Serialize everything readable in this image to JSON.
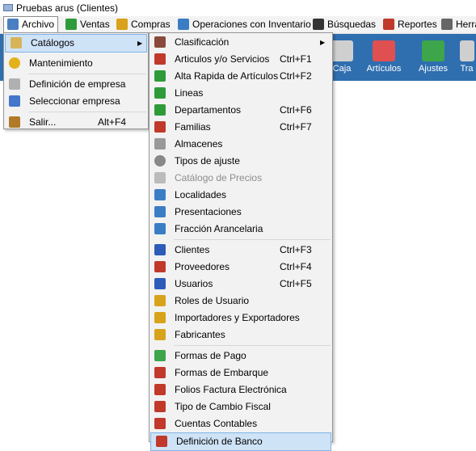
{
  "window": {
    "title": "Pruebas arus (Clientes)"
  },
  "menubar": {
    "items": [
      {
        "label": "Archivo",
        "icon": "folder-icon",
        "color": "#4a7fc1"
      },
      {
        "label": "Ventas",
        "icon": "dollar-icon",
        "color": "#2e9b3a"
      },
      {
        "label": "Compras",
        "icon": "coins-icon",
        "color": "#d9a21b"
      },
      {
        "label": "Operaciones con Inventario",
        "icon": "inventory-icon",
        "color": "#3b7dc4"
      },
      {
        "label": "Búsquedas",
        "icon": "binoculars-icon",
        "color": "#333333"
      },
      {
        "label": "Reportes",
        "icon": "report-icon",
        "color": "#c0392b"
      },
      {
        "label": "Herra",
        "icon": "wrench-icon",
        "color": "#666666"
      }
    ]
  },
  "toolbar": {
    "buttons": [
      {
        "label": "Caja",
        "icon": "cash-register-icon",
        "color": "#cfcfcf"
      },
      {
        "label": "Artículos",
        "icon": "abc-check-icon",
        "color": "#e05050"
      },
      {
        "label": "Ajustes",
        "icon": "adjust-icon",
        "color": "#3da54a"
      },
      {
        "label": "Tra",
        "icon": "transfer-icon",
        "color": "#cfcfcf"
      }
    ]
  },
  "archivo_menu": {
    "items": [
      {
        "label": "Catálogos",
        "shortcut": "",
        "submenu": true,
        "highlighted": true,
        "icon": "catalog-icon",
        "color": "#d7b45a"
      },
      {
        "label": "Mantenimiento",
        "shortcut": "",
        "icon": "maintenance-icon",
        "color": "#e3b11a"
      },
      {
        "separator": true
      },
      {
        "label": "Definición de empresa",
        "shortcut": "",
        "icon": "company-icon",
        "color": "#b0b0b0"
      },
      {
        "label": "Seleccionar empresa",
        "shortcut": "",
        "icon": "select-company-icon",
        "color": "#4477cc"
      },
      {
        "separator": true
      },
      {
        "label": "Salir...",
        "shortcut": "Alt+F4",
        "icon": "exit-icon",
        "color": "#b07a2a"
      }
    ]
  },
  "catalogos_menu": {
    "items": [
      {
        "label": "Clasificación",
        "shortcut": "",
        "submenu": true,
        "icon": "classification-icon",
        "color": "#8a4a3a"
      },
      {
        "label": "Articulos y/o Servicios",
        "shortcut": "Ctrl+F1",
        "icon": "articles-icon",
        "color": "#c0392b"
      },
      {
        "label": "Alta Rapida de Artículos",
        "shortcut": "Ctrl+F2",
        "icon": "quick-add-icon",
        "color": "#2e9b3a"
      },
      {
        "label": "Lineas",
        "shortcut": "",
        "icon": "lines-icon",
        "color": "#2e9b3a"
      },
      {
        "label": "Departamentos",
        "shortcut": "Ctrl+F6",
        "icon": "departments-icon",
        "color": "#2e9b3a"
      },
      {
        "label": "Familias",
        "shortcut": "Ctrl+F7",
        "icon": "families-icon",
        "color": "#c0392b"
      },
      {
        "label": "Almacenes",
        "shortcut": "",
        "icon": "warehouse-icon",
        "color": "#999999"
      },
      {
        "label": "Tipos de ajuste",
        "shortcut": "",
        "icon": "gear-icon",
        "color": "#888888"
      },
      {
        "label": "Catálogo de Precios",
        "shortcut": "",
        "disabled": true,
        "icon": "prices-icon",
        "color": "#bbbbbb"
      },
      {
        "label": "Localidades",
        "shortcut": "",
        "icon": "abc-check-icon",
        "color": "#3b7dc4"
      },
      {
        "label": "Presentaciones",
        "shortcut": "",
        "icon": "abc-check-icon",
        "color": "#3b7dc4"
      },
      {
        "label": "Fracción Arancelaria",
        "shortcut": "",
        "icon": "abc-check-icon",
        "color": "#3b7dc4"
      },
      {
        "separator": true
      },
      {
        "label": "Clientes",
        "shortcut": "Ctrl+F3",
        "icon": "clients-icon",
        "color": "#2e5bb8"
      },
      {
        "label": "Proveedores",
        "shortcut": "Ctrl+F4",
        "icon": "suppliers-icon",
        "color": "#c0392b"
      },
      {
        "label": "Usuarios",
        "shortcut": "Ctrl+F5",
        "icon": "users-icon",
        "color": "#2e5bb8"
      },
      {
        "label": "Roles de Usuario",
        "shortcut": "",
        "icon": "user-roles-icon",
        "color": "#d9a21b"
      },
      {
        "label": "Importadores y Exportadores",
        "shortcut": "",
        "icon": "importers-icon",
        "color": "#d9a21b"
      },
      {
        "label": "Fabricantes",
        "shortcut": "",
        "icon": "manufacturers-icon",
        "color": "#d9a21b"
      },
      {
        "separator": true
      },
      {
        "label": "Formas de Pago",
        "shortcut": "",
        "icon": "payment-icon",
        "color": "#3da54a"
      },
      {
        "label": "Formas de Embarque",
        "shortcut": "",
        "icon": "shipping-icon",
        "color": "#c0392b"
      },
      {
        "label": "Folios Factura Electrónica",
        "shortcut": "",
        "icon": "invoice-icon",
        "color": "#c0392b"
      },
      {
        "label": "Tipo de Cambio Fiscal",
        "shortcut": "",
        "icon": "exchange-icon",
        "color": "#c0392b"
      },
      {
        "label": "Cuentas Contables",
        "shortcut": "",
        "icon": "accounts-icon",
        "color": "#c0392b"
      },
      {
        "label": "Definición de Banco",
        "shortcut": "",
        "highlighted": true,
        "icon": "bank-icon",
        "color": "#c0392b"
      }
    ]
  }
}
